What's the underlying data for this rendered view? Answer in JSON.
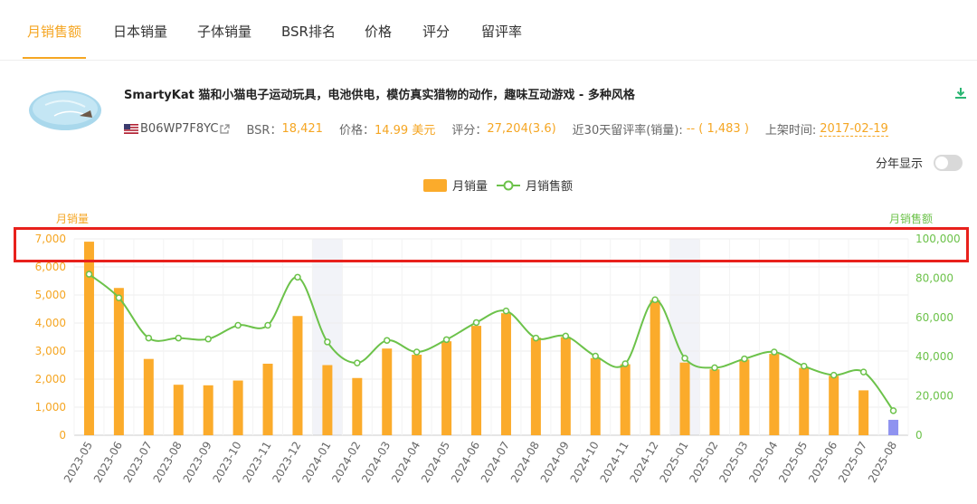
{
  "tabs": [
    {
      "label": "月销售额",
      "active": true
    },
    {
      "label": "日本销量",
      "active": false
    },
    {
      "label": "子体销量",
      "active": false
    },
    {
      "label": "BSR排名",
      "active": false
    },
    {
      "label": "价格",
      "active": false
    },
    {
      "label": "评分",
      "active": false
    },
    {
      "label": "留评率",
      "active": false
    }
  ],
  "product": {
    "title": "SmartyKat 猫和小猫电子运动玩具，电池供电，模仿真实猎物的动作，趣味互动游戏 - 多种风格",
    "asin": "B06WP7F8YC",
    "bsr_label": "BSR：",
    "bsr_value": "18,421",
    "price_label": "价格：",
    "price_value": "14.99 美元",
    "rating_label": "评分：",
    "rating_value": "27,204(3.6)",
    "review_rate_label": "近30天留评率(销量):",
    "review_rate_value": "-- ( 1,483 )",
    "listed_label": "上架时间:",
    "listed_value": "2017-02-19"
  },
  "controls": {
    "year_toggle_label": "分年显示",
    "year_toggle_on": false
  },
  "colors": {
    "accent": "#f5a623",
    "bar": "#fbab2b",
    "bar_current": "#8f93f0",
    "line": "#6cc24a",
    "highlight_box": "#e8211c",
    "year_band": "#f2f3f8"
  },
  "icons": {
    "download": "download-icon",
    "external_link": "external-link-icon",
    "flag": "us-flag-icon"
  },
  "chart_data": {
    "type": "bar",
    "legend": [
      "月销量",
      "月销售额"
    ],
    "legend_position": "top-center",
    "left_axis": {
      "label": "月销量",
      "ticks": [
        "0",
        "1,000",
        "2,000",
        "3,000",
        "4,000",
        "5,000",
        "6,000",
        "7,000"
      ],
      "range": [
        0,
        7000
      ]
    },
    "right_axis": {
      "label": "月销售额",
      "ticks": [
        "0",
        "20,000",
        "40,000",
        "60,000",
        "80,000",
        "100,000"
      ],
      "range": [
        0,
        100000
      ]
    },
    "categories": [
      "2023-05",
      "2023-06",
      "2023-07",
      "2023-08",
      "2023-09",
      "2023-10",
      "2023-11",
      "2023-12",
      "2024-01",
      "2024-02",
      "2024-03",
      "2024-04",
      "2024-05",
      "2024-06",
      "2024-07",
      "2024-08",
      "2024-09",
      "2024-10",
      "2024-11",
      "2024-12",
      "2025-01",
      "2025-02",
      "2025-03",
      "2025-04",
      "2025-05",
      "2025-06",
      "2025-07",
      "2025-08"
    ],
    "series": [
      {
        "name": "月销量",
        "type": "bar",
        "axis": "left",
        "values": [
          6900,
          5250,
          2720,
          1800,
          1780,
          1950,
          2550,
          4250,
          2500,
          2040,
          3090,
          2870,
          3350,
          3900,
          4350,
          3480,
          3500,
          2750,
          2530,
          4820,
          2590,
          2350,
          2700,
          2900,
          2400,
          2120,
          1600,
          550
        ]
      },
      {
        "name": "月销售额",
        "type": "line",
        "axis": "right",
        "smooth": true,
        "values": [
          82000,
          70000,
          49500,
          49500,
          49000,
          56000,
          56000,
          80500,
          47500,
          36800,
          48300,
          42400,
          48700,
          57400,
          63300,
          49500,
          50500,
          40300,
          36400,
          69000,
          39200,
          34400,
          38900,
          42400,
          35200,
          30600,
          32200,
          12500
        ]
      }
    ],
    "current_period": "2025-08",
    "year_start_bands": [
      "2024-01",
      "2025-01"
    ],
    "grid": true
  }
}
